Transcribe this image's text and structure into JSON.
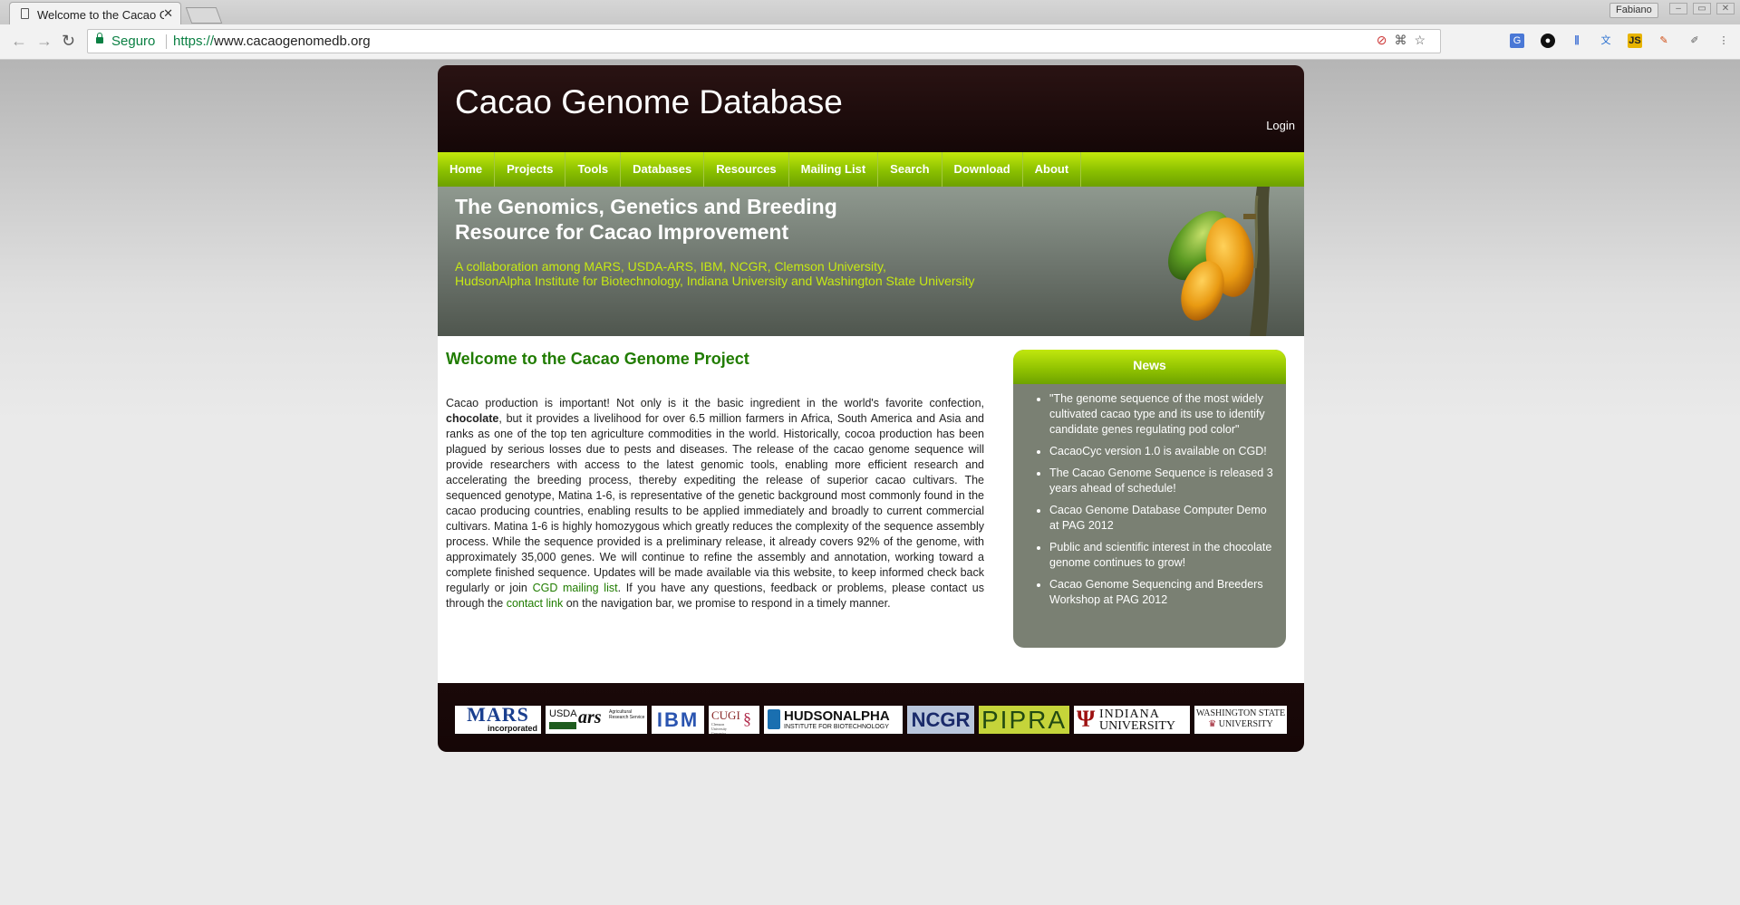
{
  "browser": {
    "tab_title": "Welcome to the Cacao Genome Project",
    "profile_name": "Fabiano",
    "secure_label": "Seguro",
    "url_scheme": "https://",
    "url_host": "www.cacaogenomedb.org"
  },
  "site": {
    "title": "Cacao Genome Database",
    "login": "Login",
    "nav": [
      "Home",
      "Projects",
      "Tools",
      "Databases",
      "Resources",
      "Mailing List",
      "Search",
      "Download",
      "About"
    ],
    "tagline_line1": "The Genomics, Genetics and Breeding",
    "tagline_line2": "Resource for Cacao Improvement",
    "collab_line1": "A collaboration among MARS, USDA-ARS, IBM, NCGR, Clemson University,",
    "collab_line2": "HudsonAlpha Institute for Biotechnology, Indiana University and Washington State University"
  },
  "main": {
    "heading": "Welcome to the Cacao Genome Project",
    "p_part1": "Cacao production is important! Not only is it the basic ingredient in the world's favorite confection, ",
    "p_bold": "chocolate",
    "p_part2": ", but it provides a livelihood for over 6.5 million farmers in Africa, South America and Asia and ranks as one of the top ten agriculture commodities in the world. Historically, cocoa production has been plagued by serious losses due to pests and diseases. The release of the cacao genome sequence will provide researchers with access to the latest genomic tools, enabling more efficient research and accelerating the breeding process, thereby expediting the release of superior cacao cultivars. The sequenced genotype, Matina 1-6, is representative of the genetic background most commonly found in the cacao producing countries, enabling results to be applied immediately and broadly to current commercial cultivars.  Matina 1-6 is highly homozygous which greatly reduces the complexity of the sequence assembly process. While the sequence provided is a preliminary release, it already covers 92% of the genome, with approximately 35,000 genes. We will continue to refine the assembly and annotation, working toward a complete finished sequence. Updates will be made available via this website, to keep informed check back regularly or  join ",
    "p_link1": "CGD mailing list",
    "p_part3": ". If you have any questions, feedback or problems, please contact us through the ",
    "p_link2": "contact link",
    "p_part4": " on the navigation bar, we promise to respond in a timely manner."
  },
  "news": {
    "title": "News",
    "items": [
      "\"The genome sequence of the most widely cultivated cacao type and its use to identify candidate genes regulating pod color\"",
      "CacaoCyc version 1.0 is available on CGD!",
      "The Cacao Genome Sequence is released 3 years ahead of schedule!",
      "Cacao Genome Database Computer Demo at PAG 2012",
      "Public and scientific interest in the chocolate genome continues to grow!",
      "Cacao Genome Sequencing and Breeders Workshop at PAG 2012"
    ]
  },
  "footer": {
    "logos": {
      "mars": "MARS",
      "mars_sub": "incorporated",
      "usda": "USDA",
      "ars": "ars",
      "ars_sub": "Agricultural Research Service",
      "ibm": "IBM",
      "cugi": "CUGI",
      "cugi_sub": "Clemson University Genomics Institute",
      "hudson": "HUDSONALPHA",
      "hudson_sub": "INSTITUTE FOR BIOTECHNOLOGY",
      "ncgr": "NCGR",
      "pipra": "PIPRA",
      "indiana": "INDIANA",
      "indiana_sub": "UNIVERSITY",
      "wsu": "WASHINGTON STATE",
      "wsu_sub": "UNIVERSITY"
    }
  }
}
